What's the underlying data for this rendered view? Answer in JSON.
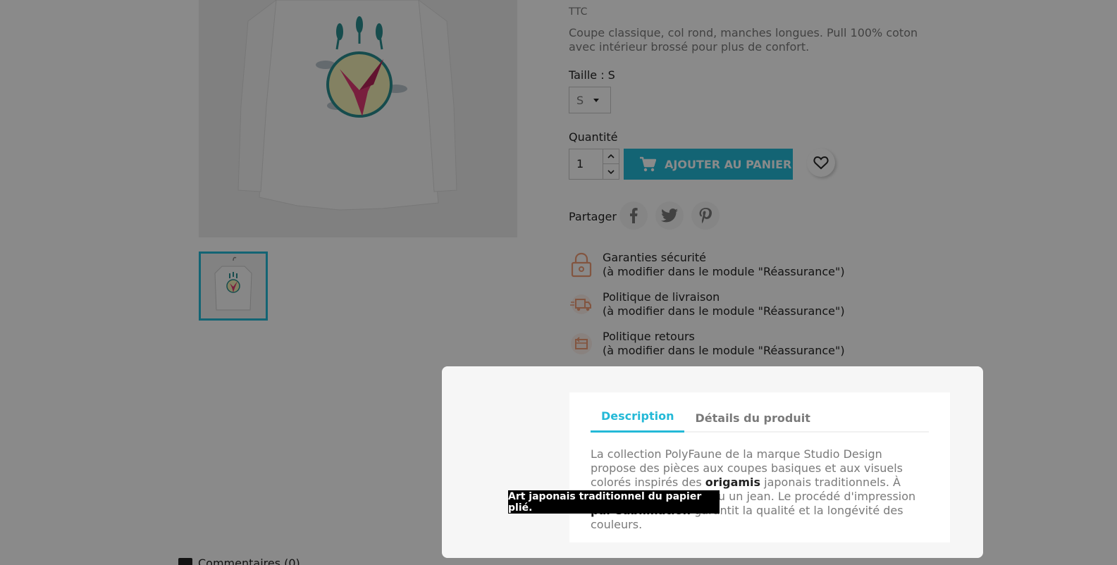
{
  "product": {
    "tax_note": "TTC",
    "short_description": "Coupe classique, col rond, manches longues. Pull 100% coton avec intérieur brossé pour plus de confort.",
    "size_label": "Taille : S",
    "size_selected": "S",
    "quantity_label": "Quantité",
    "quantity_value": "1",
    "add_to_cart_label": "AJOUTER AU PANIER",
    "share_label": "Partager"
  },
  "reassurance": [
    {
      "title": "Garanties sécurité",
      "subtitle": "(à modifier dans le module \"Réassurance\")"
    },
    {
      "title": "Politique de livraison",
      "subtitle": "(à modifier dans le module \"Réassurance\")"
    },
    {
      "title": "Politique retours",
      "subtitle": "(à modifier dans le module \"Réassurance\")"
    }
  ],
  "comments": {
    "label": "Commentaires (0)"
  },
  "modal": {
    "tabs": [
      {
        "label": "Description",
        "active": true
      },
      {
        "label": "Détails du produit",
        "active": false
      }
    ],
    "description": {
      "part1": "La collection PolyFaune de la marque Studio Design propose des pièces aux coupes basiques et aux visuels colorés inspirés des ",
      "bold1": "origamis",
      "part2": " japonais traditionnels. À porter avec un chino ou un jean. Le procédé d'impression ",
      "bold2": "par sublimation",
      "part3": " garantit la qualité et la longévité des couleurs."
    }
  },
  "tooltip": {
    "text": "Art japonais traditionnel du papier plié."
  },
  "colors": {
    "accent": "#24b9d7",
    "overlay": "rgba(0,0,0,0.46)",
    "reassurance_icon": "#f19d76"
  },
  "icons": [
    "cart-icon",
    "heart-icon",
    "facebook-icon",
    "twitter-icon",
    "pinterest-icon",
    "lock-icon",
    "truck-icon",
    "return-box-icon",
    "comment-icon"
  ]
}
